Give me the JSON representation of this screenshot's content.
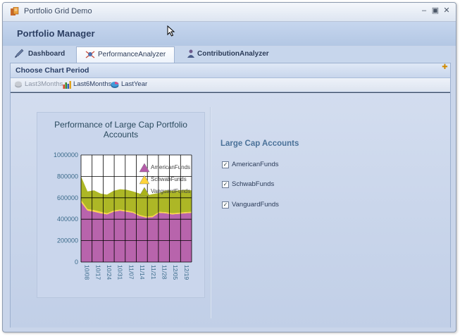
{
  "window": {
    "title": "Portfolio Grid Demo"
  },
  "header": {
    "title": "Portfolio Manager"
  },
  "tabs": [
    {
      "label": "Dashboard",
      "icon": "pen-icon"
    },
    {
      "label": "PerformanceAnalyzer",
      "icon": "analyzer-icon",
      "active": true
    },
    {
      "label": "ContributionAnalyzer",
      "icon": "people-icon"
    }
  ],
  "section": {
    "title": "Choose Chart Period"
  },
  "periods": [
    {
      "label": "Last3Months",
      "icon": "disabled-chart-icon",
      "disabled": true
    },
    {
      "label": "Last6Months",
      "icon": "bar-chart-icon"
    },
    {
      "label": "LastYear",
      "icon": "pie-chart-icon"
    }
  ],
  "accounts": {
    "title": "Large Cap Accounts",
    "items": [
      {
        "label": "AmericanFunds",
        "checked": true
      },
      {
        "label": "SchwabFunds",
        "checked": true
      },
      {
        "label": "VanguardFunds",
        "checked": true
      }
    ]
  },
  "chart_data": {
    "type": "area",
    "title": "Performance of Large Cap Portfolio Accounts",
    "ylim": [
      0,
      1000000
    ],
    "yticks": [
      "1000000",
      "800000",
      "600000",
      "400000",
      "200000",
      "0"
    ],
    "categories": [
      "10/08",
      "10/17",
      "10/24",
      "10/31",
      "11/07",
      "11/14",
      "11/21",
      "11/28",
      "12/05",
      "12/19"
    ],
    "x": [
      0,
      1,
      2,
      3,
      4,
      5,
      6,
      7,
      8,
      9,
      10,
      11,
      12,
      13,
      14,
      15,
      16,
      17
    ],
    "stacked": true,
    "series": [
      {
        "name": "AmericanFunds",
        "color": "#b45ca8",
        "values": [
          560000,
          480000,
          470000,
          455000,
          445000,
          470000,
          480000,
          470000,
          460000,
          430000,
          415000,
          420000,
          460000,
          455000,
          445000,
          450000,
          455000,
          460000
        ]
      },
      {
        "name": "SchwabFunds",
        "color": "#ffd43b",
        "values": [
          20000,
          15000,
          15000,
          15000,
          10000,
          10000,
          10000,
          10000,
          10000,
          10000,
          10000,
          10000,
          10000,
          10000,
          10000,
          10000,
          10000,
          10000
        ]
      },
      {
        "name": "VanguardFunds",
        "color": "#a9b31a",
        "values": [
          220000,
          165000,
          185000,
          170000,
          175000,
          185000,
          190000,
          195000,
          190000,
          200000,
          195000,
          205000,
          175000,
          205000,
          210000,
          210000,
          210000,
          200000
        ]
      }
    ],
    "legend": "top-right",
    "grid": true
  }
}
